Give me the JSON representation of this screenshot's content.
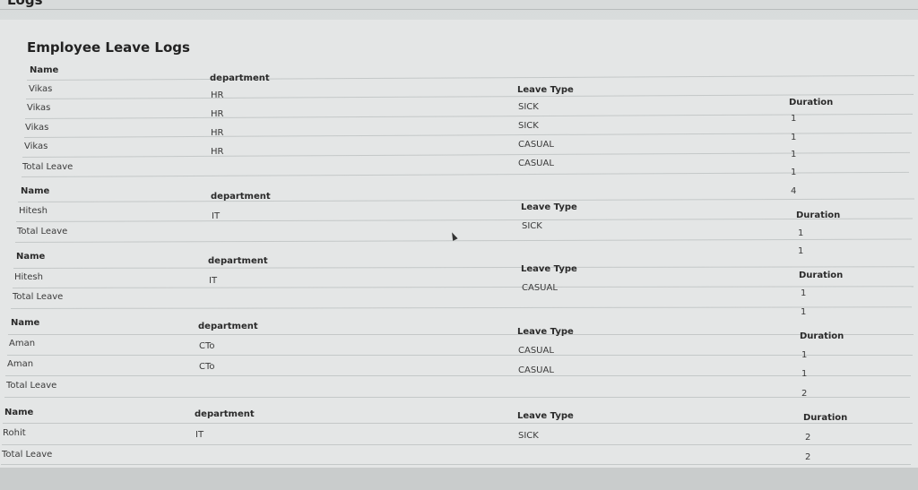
{
  "header": {
    "page_label": "Logs",
    "title": "Employee Leave Logs"
  },
  "columns": {
    "name": "Name",
    "department": "department",
    "leave_type": "Leave Type",
    "duration": "Duration",
    "total_label": "Total Leave"
  },
  "groups": [
    {
      "rows": [
        {
          "name": "Vikas",
          "department": "HR",
          "leave_type": "SICK",
          "duration": "1"
        },
        {
          "name": "Vikas",
          "department": "HR",
          "leave_type": "SICK",
          "duration": "1"
        },
        {
          "name": "Vikas",
          "department": "HR",
          "leave_type": "CASUAL",
          "duration": "1"
        },
        {
          "name": "Vikas",
          "department": "HR",
          "leave_type": "CASUAL",
          "duration": "1"
        }
      ],
      "total": "4"
    },
    {
      "rows": [
        {
          "name": "Hitesh",
          "department": "IT",
          "leave_type": "SICK",
          "duration": "1"
        }
      ],
      "total": "1"
    },
    {
      "rows": [
        {
          "name": "Hitesh",
          "department": "IT",
          "leave_type": "CASUAL",
          "duration": "1"
        }
      ],
      "total": "1"
    },
    {
      "rows": [
        {
          "name": "Aman",
          "department": "CTo",
          "leave_type": "CASUAL",
          "duration": "1"
        },
        {
          "name": "Aman",
          "department": "CTo",
          "leave_type": "CASUAL",
          "duration": "1"
        }
      ],
      "total": "2"
    },
    {
      "rows": [
        {
          "name": "Rohit",
          "department": "IT",
          "leave_type": "SICK",
          "duration": "2"
        }
      ],
      "total": "2"
    }
  ]
}
